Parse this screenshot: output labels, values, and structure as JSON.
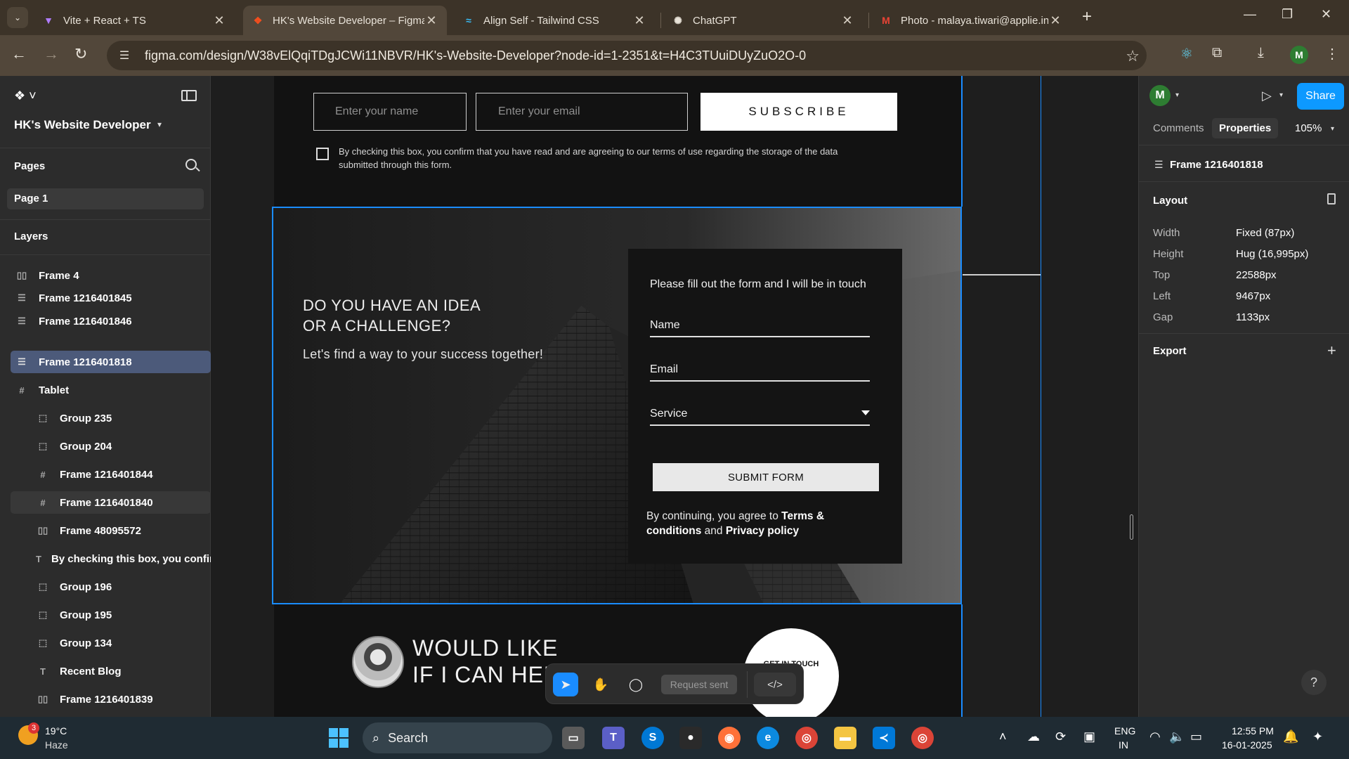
{
  "browser": {
    "tabs": [
      {
        "title": "Vite + React + TS",
        "favicon": "vite-icon"
      },
      {
        "title": "HK's Website Developer – Figma",
        "favicon": "figma-icon",
        "active": true
      },
      {
        "title": "Align Self - Tailwind CSS",
        "favicon": "tailwind-icon"
      },
      {
        "title": "ChatGPT",
        "favicon": "chatgpt-icon"
      },
      {
        "title": "Photo - malaya.tiwari@applie.in",
        "favicon": "gmail-icon"
      }
    ],
    "url": "figma.com/design/W38vElQqiTDgJCWi11NBVR/HK's-Website-Developer?node-id=1-2351&t=H4C3TUuiDUyZuO2O-0",
    "profile_initial": "M"
  },
  "left_panel": {
    "file_name": "HK's Website Developer",
    "pages_title": "Pages",
    "pages": [
      "Page 1"
    ],
    "layers_title": "Layers",
    "layers": [
      {
        "name": "Frame 4",
        "icon": "column-layout-icon",
        "depth": 0
      },
      {
        "name": "Frame 1216401845",
        "icon": "row-layout-icon",
        "depth": 0
      },
      {
        "name": "Frame 1216401846",
        "icon": "row-layout-icon",
        "depth": 0
      },
      {
        "name": "Frame 1216401818",
        "icon": "row-layout-icon",
        "depth": 0,
        "selected": true
      },
      {
        "name": "Tablet",
        "icon": "frame-icon",
        "depth": 0
      },
      {
        "name": "Group 235",
        "icon": "group-icon",
        "depth": 1
      },
      {
        "name": "Group 204",
        "icon": "group-icon",
        "depth": 1
      },
      {
        "name": "Frame 1216401844",
        "icon": "frame-icon",
        "depth": 1
      },
      {
        "name": "Frame 1216401840",
        "icon": "frame-icon",
        "depth": 1,
        "hover": true
      },
      {
        "name": "Frame 48095572",
        "icon": "column-layout-icon",
        "depth": 1
      },
      {
        "name": "By checking this box, you confirm",
        "icon": "text-icon",
        "depth": 1
      },
      {
        "name": "Group 196",
        "icon": "group-icon",
        "depth": 1
      },
      {
        "name": "Group 195",
        "icon": "group-icon",
        "depth": 1
      },
      {
        "name": "Group 134",
        "icon": "group-icon",
        "depth": 1
      },
      {
        "name": "Recent Blog",
        "icon": "text-icon",
        "depth": 1
      },
      {
        "name": "Frame 1216401839",
        "icon": "column-layout-icon",
        "depth": 1
      }
    ]
  },
  "canvas": {
    "newsletter": {
      "name_placeholder": "Enter your name",
      "email_placeholder": "Enter your email",
      "subscribe_label": "SUBSCRIBE",
      "consent_text": "By checking this box, you confirm that you have read and are agreeing to our terms of use regarding the storage of the data submitted through this form."
    },
    "contact": {
      "heading_line1": "DO YOU HAVE AN IDEA",
      "heading_line2": "OR A CHALLENGE?",
      "subheading": "Let's find a way to your success together!",
      "form_intro": "Please fill out the form and I will be in touch",
      "field_name": "Name",
      "field_email": "Email",
      "field_service": "Service",
      "submit_label": "SUBMIT FORM",
      "terms_prefix": "By continuing, you agree to ",
      "terms_link": "Terms & conditions",
      "terms_and": " and ",
      "privacy_link": "Privacy policy"
    },
    "cta": {
      "line1": "WOULD LIKE",
      "line2": "IF I CAN HELP?",
      "button_label": "GET IN TOUCH"
    },
    "toolbar": {
      "request_label": "Request sent",
      "code_label": "</>"
    }
  },
  "right_panel": {
    "user_initial": "M",
    "share_label": "Share",
    "tab_comments": "Comments",
    "tab_properties": "Properties",
    "zoom": "105%",
    "frame_name": "Frame 1216401818",
    "layout_title": "Layout",
    "properties": [
      {
        "label": "Width",
        "value": "Fixed (87px)"
      },
      {
        "label": "Height",
        "value": "Hug (16,995px)"
      },
      {
        "label": "Top",
        "value": "22588px"
      },
      {
        "label": "Left",
        "value": "9467px"
      },
      {
        "label": "Gap",
        "value": "1133px"
      }
    ],
    "export_title": "Export",
    "help_label": "?"
  },
  "taskbar": {
    "weather_temp": "19°C",
    "weather_cond": "Haze",
    "weather_badge": "3",
    "search_label": "Search",
    "lang_line1": "ENG",
    "lang_line2": "IN",
    "time": "12:55 PM",
    "date": "16-01-2025"
  },
  "colors": {
    "selection": "#1a8cff",
    "share_button": "#0d99ff",
    "layer_selected": "#4c5a7a",
    "browser_frame": "#3c3328"
  }
}
